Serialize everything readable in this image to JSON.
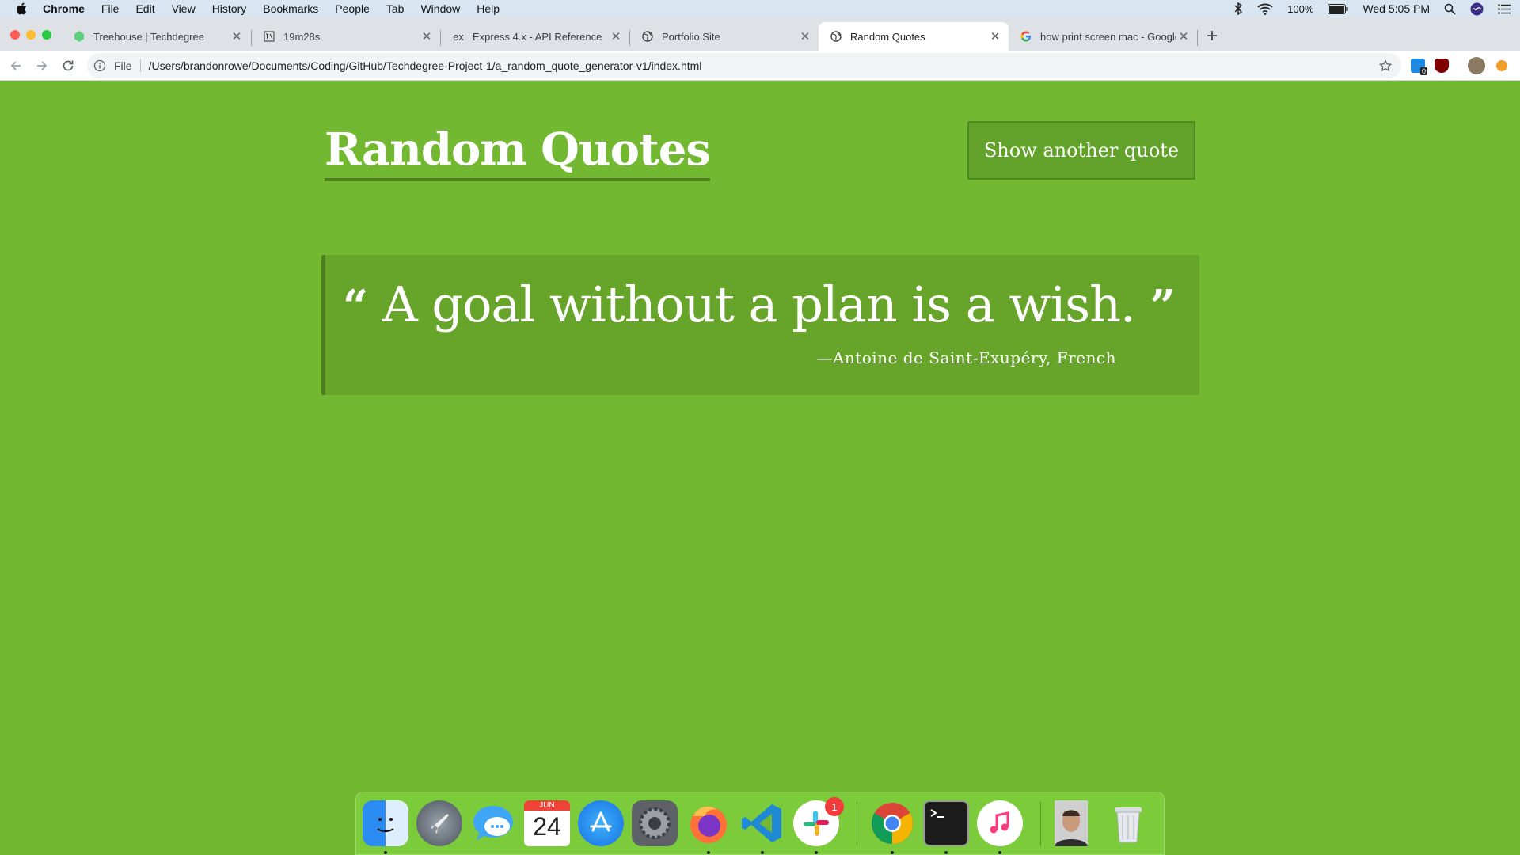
{
  "menubar": {
    "app": "Chrome",
    "items": [
      "File",
      "Edit",
      "View",
      "History",
      "Bookmarks",
      "People",
      "Tab",
      "Window",
      "Help"
    ],
    "battery": "100%",
    "clock": "Wed 5:05 PM"
  },
  "tabs": [
    {
      "title": "Treehouse | Techdegree",
      "favicon": "treehouse-icon"
    },
    {
      "title": "19m28s",
      "favicon": "timer-icon"
    },
    {
      "title": "Express 4.x - API Reference",
      "favicon": "express-icon",
      "fav_text": "ex"
    },
    {
      "title": "Portfolio Site",
      "favicon": "globe-icon"
    },
    {
      "title": "Random Quotes",
      "favicon": "globe-icon",
      "active": true
    },
    {
      "title": "how print screen mac - Google",
      "favicon": "google-icon"
    }
  ],
  "toolbar": {
    "scheme": "File",
    "url": "/Users/brandonrowe/Documents/Coding/GitHub/Techdegree-Project-1/a_random_quote_generator-v1/index.html",
    "ext_badge": "0"
  },
  "page": {
    "title": "Random Quotes",
    "button_label": "Show another quote",
    "quote_open": "“",
    "quote": "A goal without a plan is a wish.",
    "quote_close": "”",
    "source": "—Antoine de Saint-Exupéry, French",
    "colors": {
      "background": "#72b831",
      "quote_box": "#66a52a",
      "accent": "#4d7f1f"
    }
  },
  "dock": {
    "apps": [
      "finder-icon",
      "launchpad-icon",
      "messages-icon",
      "calendar-icon",
      "app-store-icon",
      "system-preferences-icon",
      "firefox-icon",
      "vscode-icon",
      "slack-icon",
      "chrome-icon",
      "terminal-icon",
      "itunes-icon",
      "photo-icon",
      "trash-icon"
    ],
    "calendar_month": "JUN",
    "calendar_day": "24",
    "slack_badge": "1"
  }
}
